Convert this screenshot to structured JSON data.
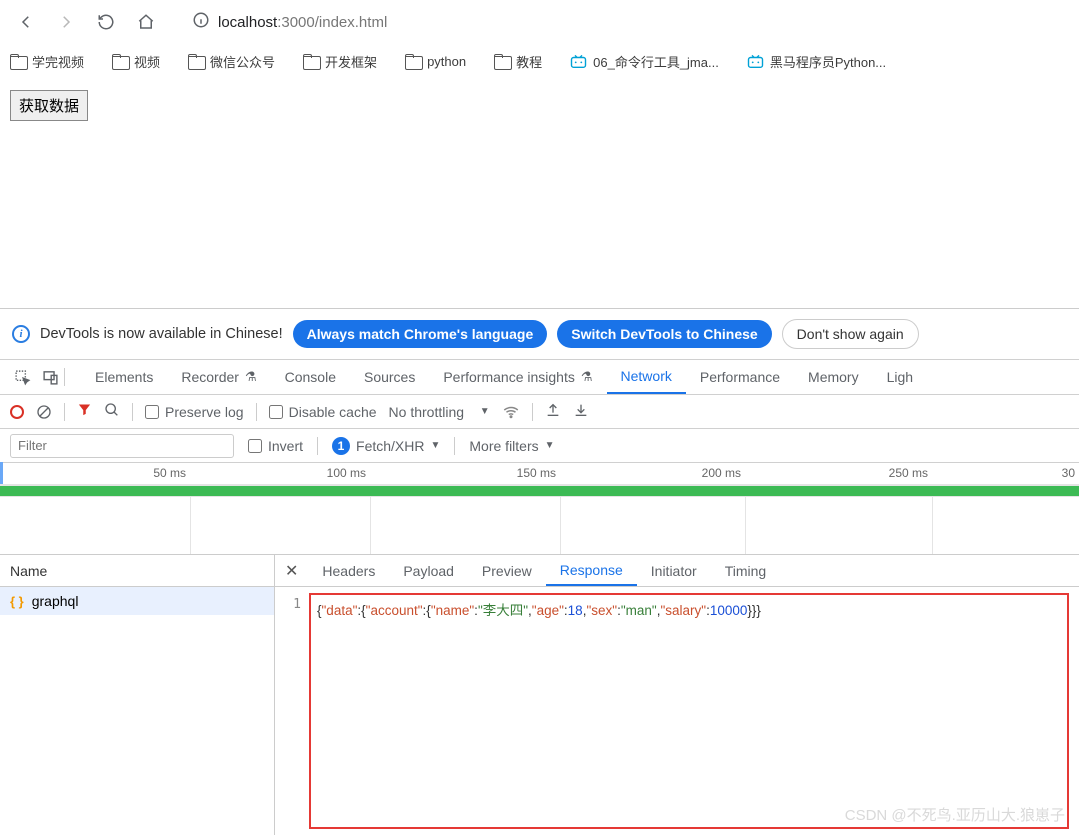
{
  "browser": {
    "url_host": "localhost",
    "url_port_path": ":3000/index.html",
    "bookmarks": [
      {
        "label": "学完视频",
        "type": "folder"
      },
      {
        "label": "视频",
        "type": "folder"
      },
      {
        "label": "微信公众号",
        "type": "folder"
      },
      {
        "label": "开发框架",
        "type": "folder"
      },
      {
        "label": "python",
        "type": "folder"
      },
      {
        "label": "教程",
        "type": "folder"
      },
      {
        "label": "06_命令行工具_jma...",
        "type": "bili"
      },
      {
        "label": "黑马程序员Python...",
        "type": "bili"
      }
    ]
  },
  "page": {
    "button_label": "获取数据"
  },
  "devtools": {
    "notice": {
      "text": "DevTools is now available in Chinese!",
      "btn1": "Always match Chrome's language",
      "btn2": "Switch DevTools to Chinese",
      "btn3": "Don't show again"
    },
    "tabs": {
      "elements": "Elements",
      "recorder": "Recorder",
      "console": "Console",
      "sources": "Sources",
      "perf_insights": "Performance insights",
      "network": "Network",
      "performance": "Performance",
      "memory": "Memory",
      "light": "Ligh"
    },
    "toolbar": {
      "preserve": "Preserve log",
      "disable_cache": "Disable cache",
      "throttling": "No throttling"
    },
    "filter": {
      "placeholder": "Filter",
      "invert": "Invert",
      "badge": "1",
      "fetch": "Fetch/XHR",
      "more": "More filters"
    },
    "timeline": {
      "ticks": [
        "50 ms",
        "100 ms",
        "150 ms",
        "200 ms",
        "250 ms",
        "30"
      ]
    },
    "requests": {
      "header": "Name",
      "row0": "graphql"
    },
    "detail_tabs": {
      "headers": "Headers",
      "payload": "Payload",
      "preview": "Preview",
      "response": "Response",
      "initiator": "Initiator",
      "timing": "Timing"
    },
    "response_line_no": "1",
    "response_data": {
      "data": {
        "account": {
          "name": "李大四",
          "age": 18,
          "sex": "man",
          "salary": 10000
        }
      }
    }
  },
  "watermark": "CSDN @不死鸟.亚历山大.狼崽子"
}
